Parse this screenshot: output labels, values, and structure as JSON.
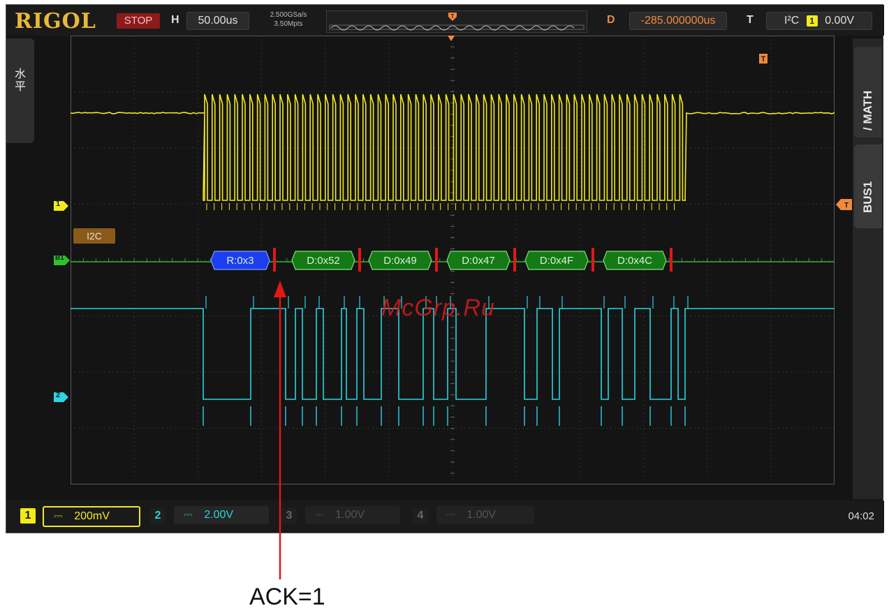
{
  "topbar": {
    "brand": "RIGOL",
    "run_state": "STOP",
    "timebase_label": "H",
    "timebase_value": "50.00us",
    "sample_rate": "2.500GSa/s",
    "memory_depth": "3.50Mpts",
    "delay_label": "D",
    "delay_value": "-285.000000us",
    "trigger_label": "T",
    "trigger_type": "I²C",
    "trigger_source": "1",
    "trigger_level": "0.00V"
  },
  "left_tab": {
    "label": "水平"
  },
  "right_tabs": {
    "math": "MATH",
    "bus": "BUS1"
  },
  "markers": {
    "ch1": "1",
    "ch2": "2",
    "bus": "B1"
  },
  "bus_label": "I2C",
  "decode": {
    "packets": [
      "R:0x3",
      "D:0x52",
      "D:0x49",
      "D:0x47",
      "D:0x4F",
      "D:0x4C"
    ]
  },
  "bottombar": {
    "channels": [
      {
        "num": "1",
        "coupling": "⎓",
        "scale": "200mV"
      },
      {
        "num": "2",
        "coupling": "⎓",
        "scale": "2.00V"
      },
      {
        "num": "3",
        "coupling": "⎓",
        "scale": "1.00V"
      },
      {
        "num": "4",
        "coupling": "⎓",
        "scale": "1.00V"
      }
    ],
    "time": "04:02"
  },
  "watermark": "McGrp.Ru",
  "annotation": "ACK=1",
  "colors": {
    "ch1": "#f2ea1c",
    "ch2": "#2ad4e0",
    "bus": "#2cc02c",
    "trigger": "#f08a3c",
    "accent_red": "#e01818"
  }
}
